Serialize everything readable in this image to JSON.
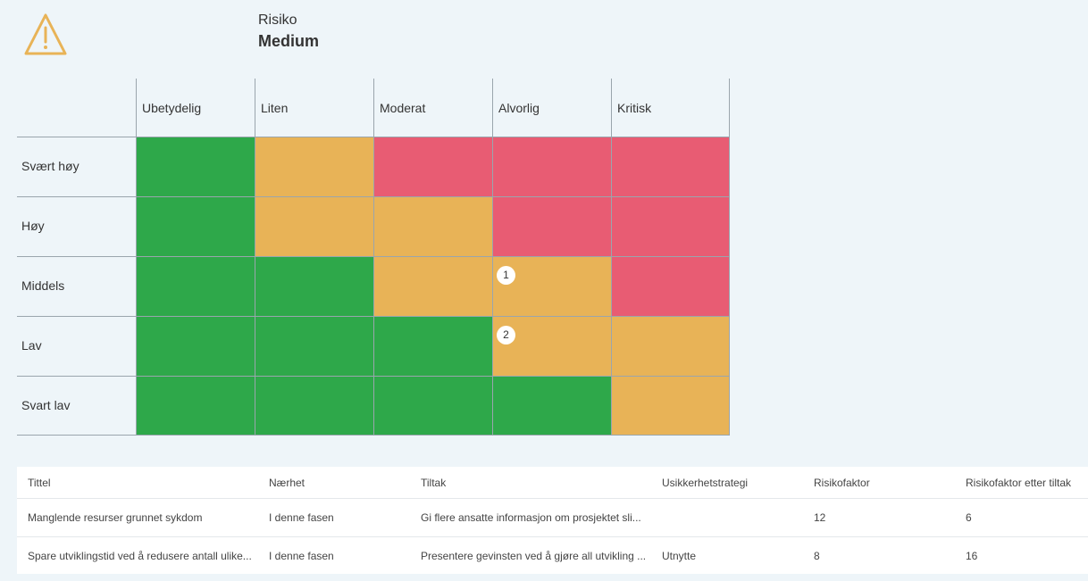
{
  "header": {
    "label": "Risiko",
    "value": "Medium",
    "icon": "warning-triangle-icon",
    "icon_color": "#e8b357"
  },
  "matrix": {
    "columns": [
      "Ubetydelig",
      "Liten",
      "Moderat",
      "Alvorlig",
      "Kritisk"
    ],
    "rows": [
      {
        "label": "Svært høy",
        "cells": [
          "green",
          "yellow",
          "red",
          "red",
          "red"
        ]
      },
      {
        "label": "Høy",
        "cells": [
          "green",
          "yellow",
          "yellow",
          "red",
          "red"
        ]
      },
      {
        "label": "Middels",
        "cells": [
          "green",
          "green",
          "yellow",
          "yellow",
          "red"
        ]
      },
      {
        "label": "Lav",
        "cells": [
          "green",
          "green",
          "green",
          "yellow",
          "yellow"
        ]
      },
      {
        "label": "Svart lav",
        "cells": [
          "green",
          "green",
          "green",
          "green",
          "yellow"
        ]
      }
    ],
    "markers": [
      {
        "label": "1",
        "row": 2,
        "col": 3
      },
      {
        "label": "2",
        "row": 3,
        "col": 3
      }
    ],
    "colors": {
      "green": "#2ea84a",
      "yellow": "#e8b357",
      "red": "#e85c73"
    }
  },
  "table": {
    "headers": [
      "Tittel",
      "Nærhet",
      "Tiltak",
      "Usikkerhetstrategi",
      "Risikofaktor",
      "Risikofaktor etter tiltak"
    ],
    "rows": [
      [
        "Manglende resurser grunnet sykdom",
        "I denne fasen",
        "Gi flere ansatte informasjon om prosjektet sli...",
        "",
        "12",
        "6"
      ],
      [
        "Spare utviklingstid ved å redusere antall ulike...",
        "I denne fasen",
        "Presentere gevinsten ved å gjøre all utvikling ...",
        "Utnytte",
        "8",
        "16"
      ]
    ]
  }
}
